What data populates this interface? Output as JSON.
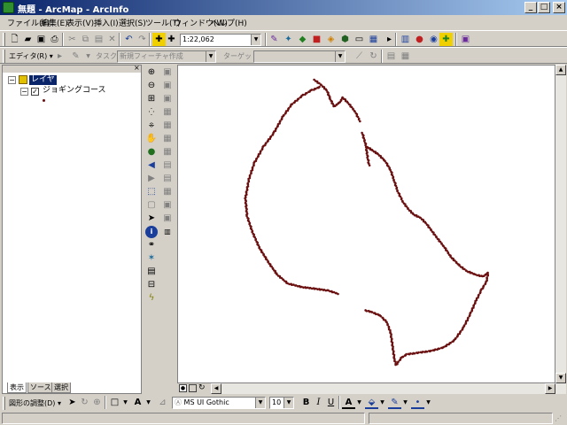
{
  "window": {
    "title": "無題 - ArcMap - ArcInfo",
    "minimize": "_",
    "maximize": "□",
    "close": "×"
  },
  "menu": [
    "ファイル(F)",
    "編集(E)",
    "表示(V)",
    "挿入(I)",
    "選択(S)",
    "ツール(T)",
    "ウィンドウ(W)",
    "ヘルプ(H)"
  ],
  "standard_toolbar": {
    "scale": "1:22,062"
  },
  "editor_toolbar": {
    "editor_label": "エディタ(R) ▾",
    "task_label": "タスク:",
    "task_value": "新規フィーチャ作成",
    "target_label": "ターゲット:",
    "target_value": ""
  },
  "toc": {
    "layer_root": "レイヤ",
    "layer_item": "ジョギングコース",
    "tabs": [
      "表示",
      "ソース",
      "選択"
    ]
  },
  "drawing_toolbar": {
    "drawing_label": "図形の調整(D) ▾",
    "font_value": "MS UI Gothic",
    "font_size": "10",
    "bold": "B",
    "italic": "I",
    "underline": "U",
    "font_color_glyph": "A"
  },
  "colors": {
    "title_start": "#0a246a",
    "title_end": "#a6caf0",
    "track_point": "#6b1010",
    "layer_highlight": "#0a246a"
  }
}
